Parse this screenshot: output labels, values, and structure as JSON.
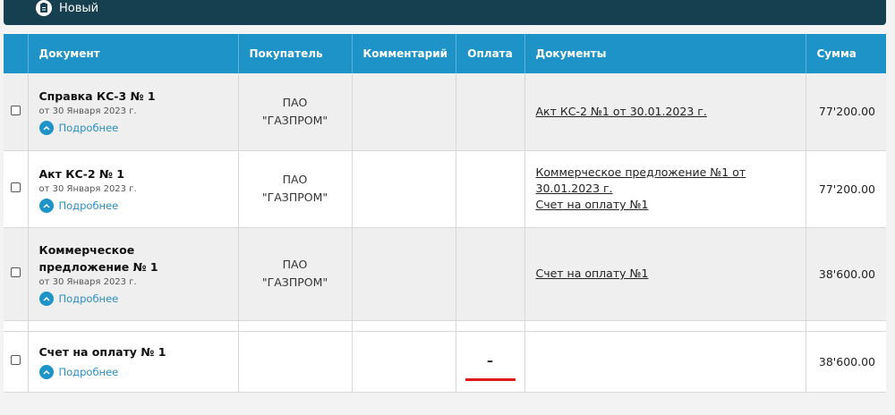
{
  "toolbar": {
    "new_label": "Новый",
    "icon": "document-icon"
  },
  "table": {
    "headers": [
      "Документ",
      "Покупатель",
      "Комментарий",
      "Оплата",
      "Документы",
      "Сумма"
    ],
    "more_label": "Подробнее",
    "rows": [
      {
        "title": "Справка КС-3 № 1",
        "date": "от 30 Января 2023 г.",
        "buyer_line1": "ПАО",
        "buyer_line2": "\"ГАЗПРОМ\"",
        "comment": "",
        "payment": "",
        "docs": [
          "Акт КС-2 №1 от 30.01.2023 г."
        ],
        "sum": "77'200.00"
      },
      {
        "title": "Акт КС-2 № 1",
        "date": "от 30 Января 2023 г.",
        "buyer_line1": "ПАО",
        "buyer_line2": "\"ГАЗПРОМ\"",
        "comment": "",
        "payment": "",
        "docs": [
          "Коммерческое предложение №1 от 30.01.2023 г.",
          "Счет на оплату №1"
        ],
        "sum": "77'200.00"
      },
      {
        "title": "Коммерческое предложение № 1",
        "date": "от 30 Января 2023 г.",
        "buyer_line1": "ПАО",
        "buyer_line2": "\"ГАЗПРОМ\"",
        "comment": "",
        "payment": "",
        "docs": [
          "Счет на оплату №1"
        ],
        "sum": "38'600.00"
      },
      {
        "title": "Счет на оплату № 1",
        "date": "",
        "buyer_line1": "",
        "buyer_line2": "",
        "comment": "",
        "payment": "–",
        "docs": [],
        "sum": "38'600.00"
      }
    ]
  },
  "colors": {
    "header_bg": "#1e93c8",
    "topbar_bg": "#163f4f",
    "highlight": "#e01919"
  }
}
